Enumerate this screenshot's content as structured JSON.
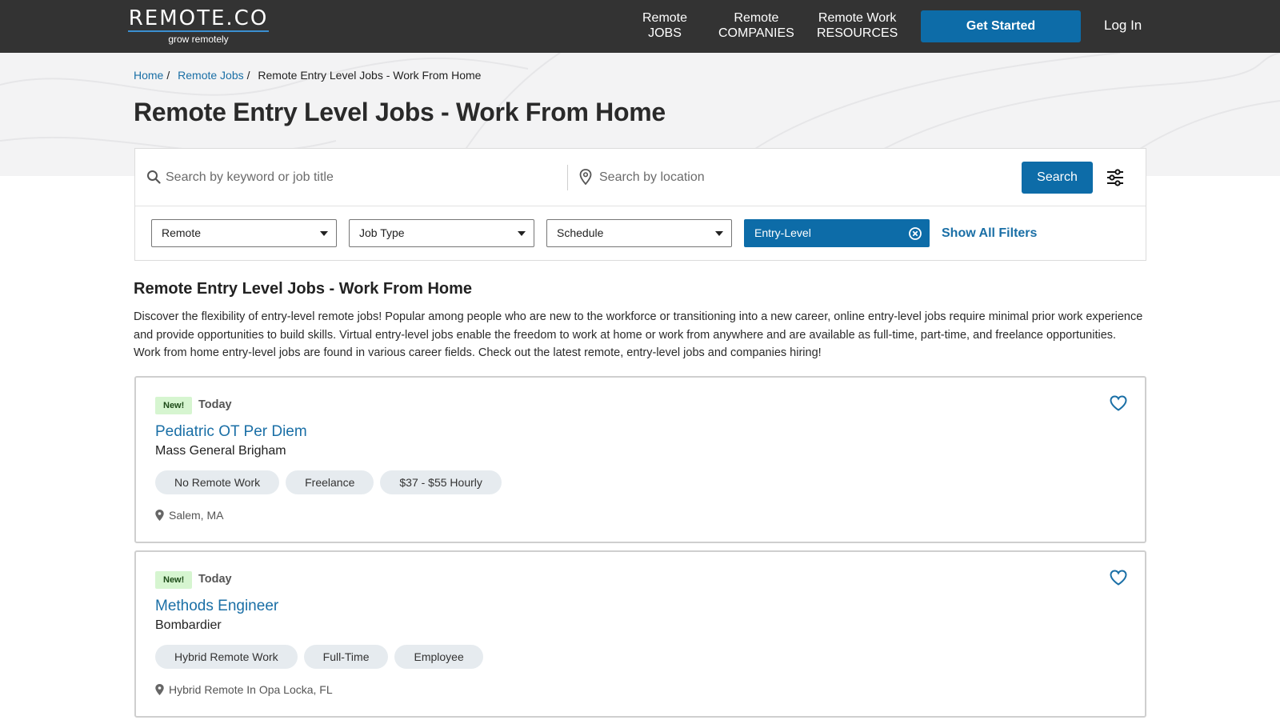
{
  "header": {
    "logo_text": "REMOTE.CO",
    "logo_tagline": "grow remotely",
    "nav": [
      {
        "top": "Remote",
        "bottom": "JOBS"
      },
      {
        "top": "Remote",
        "bottom": "COMPANIES"
      },
      {
        "top": "Remote Work",
        "bottom": "RESOURCES"
      }
    ],
    "cta_label": "Get Started",
    "login_label": "Log In"
  },
  "breadcrumb": {
    "items": [
      "Home",
      "Remote Jobs"
    ],
    "current": "Remote Entry Level Jobs - Work From Home"
  },
  "page_title": "Remote Entry Level Jobs - Work From Home",
  "search": {
    "keyword_placeholder": "Search by keyword or job title",
    "location_placeholder": "Search by location",
    "button_label": "Search",
    "icons": {
      "keyword": "search-icon",
      "location": "map-pin-icon",
      "filters": "sliders-icon"
    }
  },
  "filters": {
    "dropdowns": [
      "Remote",
      "Job Type",
      "Schedule"
    ],
    "active_filter": "Entry-Level",
    "show_all_label": "Show All Filters"
  },
  "intro": {
    "title": "Remote Entry Level Jobs - Work From Home",
    "text": "Discover the flexibility of entry-level remote jobs! Popular among people who are new to the workforce or transitioning into a new career, online entry-level jobs require minimal prior work experience and provide opportunities to build skills. Virtual entry-level jobs enable the freedom to work at home or work from anywhere and are available as full-time, part-time, and freelance opportunities. Work from home entry-level jobs are found in various career fields. Check out the latest remote, entry-level jobs and companies hiring!"
  },
  "jobs": [
    {
      "badge": "New!",
      "posted": "Today",
      "title": "Pediatric OT Per Diem",
      "company": "Mass General Brigham",
      "tags": [
        "No Remote Work",
        "Freelance",
        "$37 - $55 Hourly"
      ],
      "location": "Salem, MA"
    },
    {
      "badge": "New!",
      "posted": "Today",
      "title": "Methods Engineer",
      "company": "Bombardier",
      "tags": [
        "Hybrid Remote Work",
        "Full-Time",
        "Employee"
      ],
      "location": "Hybrid Remote In Opa Locka, FL"
    }
  ],
  "colors": {
    "header_bg": "#333333",
    "primary": "#0d6ca8",
    "link": "#1a6fa6",
    "new_badge": "#d6f5d0",
    "tag_bg": "#e6ebef"
  }
}
